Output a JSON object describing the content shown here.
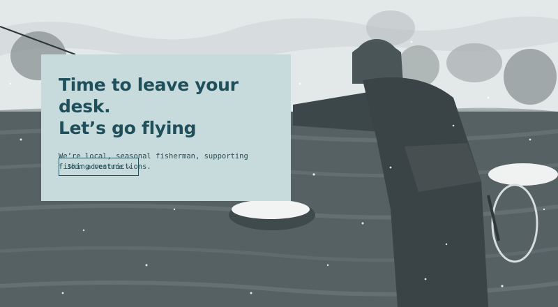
{
  "hero": {
    "title_line1": "Time to leave your desk.",
    "title_line2": "Let’s go flying",
    "subtitle": "We’re local, seasonal fisherman, supporting fishing restrictions.",
    "button_label": "Join adventure",
    "button_icon": "arrow-right-icon"
  },
  "colors": {
    "card_bg": "#c7dadc",
    "title": "#1f4f5a",
    "body_text": "#2b4e55"
  }
}
